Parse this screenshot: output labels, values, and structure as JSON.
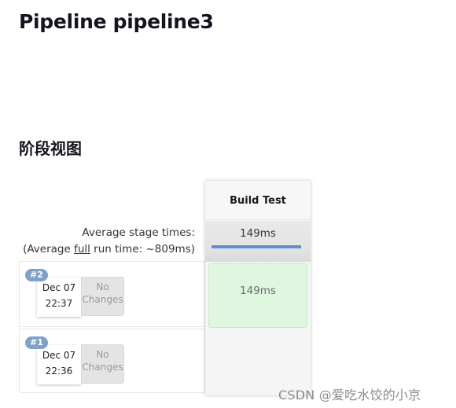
{
  "page": {
    "title": "Pipeline pipeline3",
    "section_title": "阶段视图"
  },
  "summary": {
    "avg_stage_label": "Average stage times:",
    "avg_run_prefix": "(Average ",
    "avg_run_underlined": "full",
    "avg_run_suffix": " run time: ~809ms)"
  },
  "stages": [
    {
      "name": "Build Test",
      "avg_time": "149ms",
      "avg_progress_percent": 100
    }
  ],
  "runs": [
    {
      "badge": "#2",
      "date": "Dec 07",
      "time": "22:37",
      "changes_line1": "No",
      "changes_line2": "Changes",
      "stage_results": [
        "149ms"
      ],
      "status_color": "#dff7df"
    },
    {
      "badge": "#1",
      "date": "Dec 07",
      "time": "22:36",
      "changes_line1": "No",
      "changes_line2": "Changes",
      "stage_results": [
        ""
      ]
    }
  ],
  "colors": {
    "badge_bg": "#7ea1c9",
    "progress_fill": "#5d8fd3",
    "success_cell": "#dff7df"
  },
  "watermark": "CSDN @爱吃水饺的小京"
}
